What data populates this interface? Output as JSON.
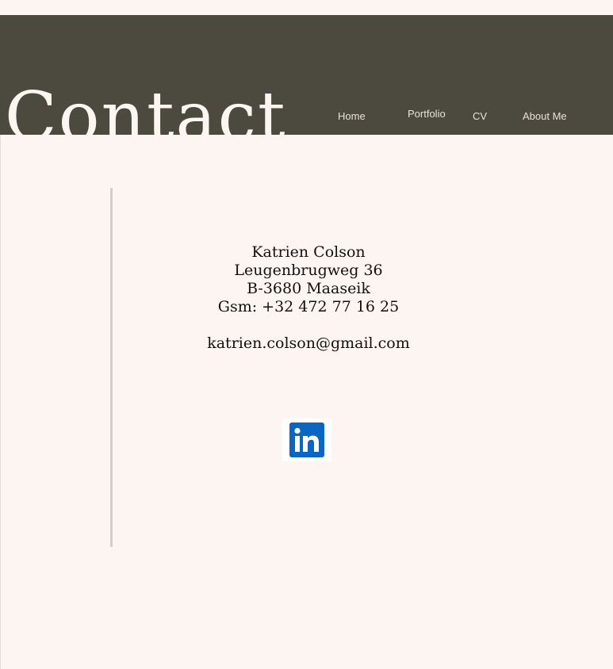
{
  "header": {
    "title": "Contact",
    "background": "#4c4a3e"
  },
  "nav": {
    "items": [
      {
        "label": "Home"
      },
      {
        "label": "Portfolio"
      },
      {
        "label": "CV"
      },
      {
        "label": "About Me"
      }
    ]
  },
  "contact": {
    "name": "Katrien Colson",
    "street": "Leugenbrugweg 36",
    "city": "B-3680 Maaseik",
    "phone": "Gsm: +32 472 77 16 25",
    "email": "katrien.colson@gmail.com"
  },
  "social": {
    "linkedin_icon": "linkedin-icon",
    "linkedin_color": "#0a66c2"
  },
  "colors": {
    "page_background": "#fdf5f2",
    "divider": "#d8cdc4",
    "text": "#111111"
  }
}
